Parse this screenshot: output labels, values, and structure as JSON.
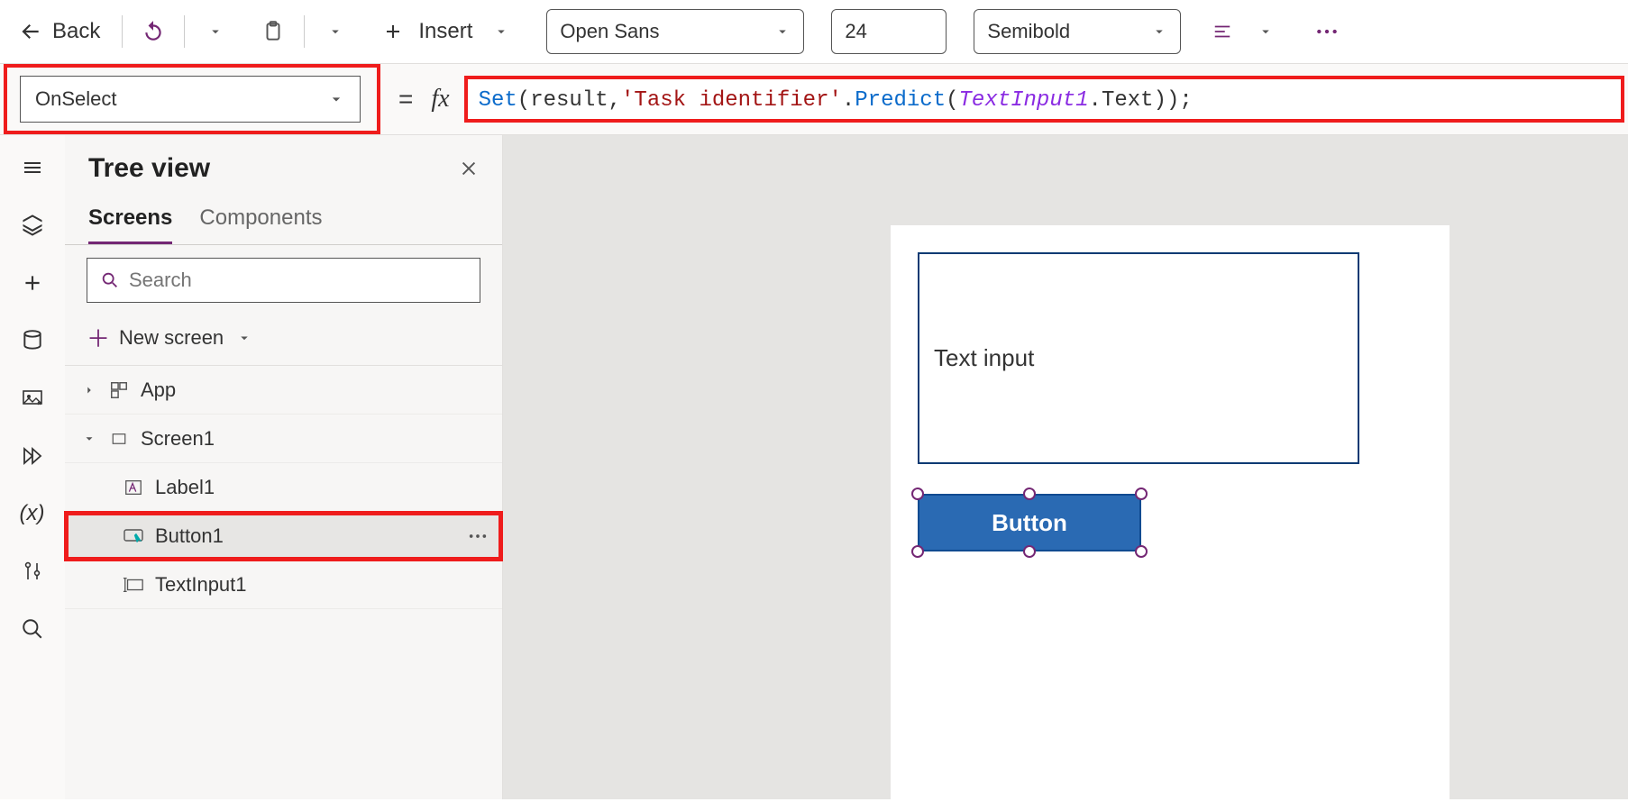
{
  "toolbar": {
    "back_label": "Back",
    "insert_label": "Insert",
    "font_name": "Open Sans",
    "font_size": "24",
    "font_weight": "Semibold"
  },
  "formula": {
    "property": "OnSelect",
    "fn_set": "Set",
    "open1": "(",
    "arg1": "result",
    "comma": ", ",
    "str": "'Task identifier'",
    "dot1": ".",
    "fn_predict": "Predict",
    "open2": "(",
    "id_textinput": "TextInput1",
    "dot2": ".",
    "prop_text": "Text",
    "close": "));"
  },
  "tree": {
    "title": "Tree view",
    "tab_screens": "Screens",
    "tab_components": "Components",
    "search_placeholder": "Search",
    "new_screen_label": "New screen",
    "app_label": "App",
    "screen1_label": "Screen1",
    "label1_label": "Label1",
    "button1_label": "Button1",
    "textinput1_label": "TextInput1"
  },
  "canvas": {
    "text_input_value": "Text input",
    "button_label": "Button"
  }
}
